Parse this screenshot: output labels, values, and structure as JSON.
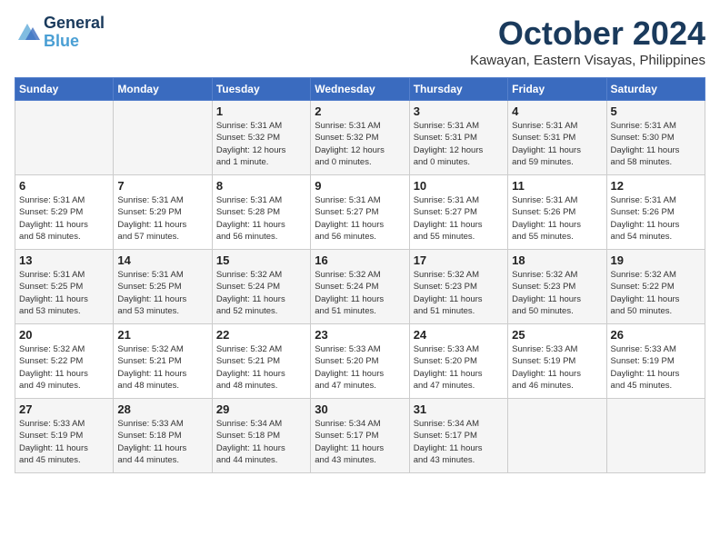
{
  "header": {
    "logo_line1": "General",
    "logo_line2": "Blue",
    "month": "October 2024",
    "location": "Kawayan, Eastern Visayas, Philippines"
  },
  "days_of_week": [
    "Sunday",
    "Monday",
    "Tuesday",
    "Wednesday",
    "Thursday",
    "Friday",
    "Saturday"
  ],
  "weeks": [
    [
      {
        "day": "",
        "info": ""
      },
      {
        "day": "",
        "info": ""
      },
      {
        "day": "1",
        "info": "Sunrise: 5:31 AM\nSunset: 5:32 PM\nDaylight: 12 hours\nand 1 minute."
      },
      {
        "day": "2",
        "info": "Sunrise: 5:31 AM\nSunset: 5:32 PM\nDaylight: 12 hours\nand 0 minutes."
      },
      {
        "day": "3",
        "info": "Sunrise: 5:31 AM\nSunset: 5:31 PM\nDaylight: 12 hours\nand 0 minutes."
      },
      {
        "day": "4",
        "info": "Sunrise: 5:31 AM\nSunset: 5:31 PM\nDaylight: 11 hours\nand 59 minutes."
      },
      {
        "day": "5",
        "info": "Sunrise: 5:31 AM\nSunset: 5:30 PM\nDaylight: 11 hours\nand 58 minutes."
      }
    ],
    [
      {
        "day": "6",
        "info": "Sunrise: 5:31 AM\nSunset: 5:29 PM\nDaylight: 11 hours\nand 58 minutes."
      },
      {
        "day": "7",
        "info": "Sunrise: 5:31 AM\nSunset: 5:29 PM\nDaylight: 11 hours\nand 57 minutes."
      },
      {
        "day": "8",
        "info": "Sunrise: 5:31 AM\nSunset: 5:28 PM\nDaylight: 11 hours\nand 56 minutes."
      },
      {
        "day": "9",
        "info": "Sunrise: 5:31 AM\nSunset: 5:27 PM\nDaylight: 11 hours\nand 56 minutes."
      },
      {
        "day": "10",
        "info": "Sunrise: 5:31 AM\nSunset: 5:27 PM\nDaylight: 11 hours\nand 55 minutes."
      },
      {
        "day": "11",
        "info": "Sunrise: 5:31 AM\nSunset: 5:26 PM\nDaylight: 11 hours\nand 55 minutes."
      },
      {
        "day": "12",
        "info": "Sunrise: 5:31 AM\nSunset: 5:26 PM\nDaylight: 11 hours\nand 54 minutes."
      }
    ],
    [
      {
        "day": "13",
        "info": "Sunrise: 5:31 AM\nSunset: 5:25 PM\nDaylight: 11 hours\nand 53 minutes."
      },
      {
        "day": "14",
        "info": "Sunrise: 5:31 AM\nSunset: 5:25 PM\nDaylight: 11 hours\nand 53 minutes."
      },
      {
        "day": "15",
        "info": "Sunrise: 5:32 AM\nSunset: 5:24 PM\nDaylight: 11 hours\nand 52 minutes."
      },
      {
        "day": "16",
        "info": "Sunrise: 5:32 AM\nSunset: 5:24 PM\nDaylight: 11 hours\nand 51 minutes."
      },
      {
        "day": "17",
        "info": "Sunrise: 5:32 AM\nSunset: 5:23 PM\nDaylight: 11 hours\nand 51 minutes."
      },
      {
        "day": "18",
        "info": "Sunrise: 5:32 AM\nSunset: 5:23 PM\nDaylight: 11 hours\nand 50 minutes."
      },
      {
        "day": "19",
        "info": "Sunrise: 5:32 AM\nSunset: 5:22 PM\nDaylight: 11 hours\nand 50 minutes."
      }
    ],
    [
      {
        "day": "20",
        "info": "Sunrise: 5:32 AM\nSunset: 5:22 PM\nDaylight: 11 hours\nand 49 minutes."
      },
      {
        "day": "21",
        "info": "Sunrise: 5:32 AM\nSunset: 5:21 PM\nDaylight: 11 hours\nand 48 minutes."
      },
      {
        "day": "22",
        "info": "Sunrise: 5:32 AM\nSunset: 5:21 PM\nDaylight: 11 hours\nand 48 minutes."
      },
      {
        "day": "23",
        "info": "Sunrise: 5:33 AM\nSunset: 5:20 PM\nDaylight: 11 hours\nand 47 minutes."
      },
      {
        "day": "24",
        "info": "Sunrise: 5:33 AM\nSunset: 5:20 PM\nDaylight: 11 hours\nand 47 minutes."
      },
      {
        "day": "25",
        "info": "Sunrise: 5:33 AM\nSunset: 5:19 PM\nDaylight: 11 hours\nand 46 minutes."
      },
      {
        "day": "26",
        "info": "Sunrise: 5:33 AM\nSunset: 5:19 PM\nDaylight: 11 hours\nand 45 minutes."
      }
    ],
    [
      {
        "day": "27",
        "info": "Sunrise: 5:33 AM\nSunset: 5:19 PM\nDaylight: 11 hours\nand 45 minutes."
      },
      {
        "day": "28",
        "info": "Sunrise: 5:33 AM\nSunset: 5:18 PM\nDaylight: 11 hours\nand 44 minutes."
      },
      {
        "day": "29",
        "info": "Sunrise: 5:34 AM\nSunset: 5:18 PM\nDaylight: 11 hours\nand 44 minutes."
      },
      {
        "day": "30",
        "info": "Sunrise: 5:34 AM\nSunset: 5:17 PM\nDaylight: 11 hours\nand 43 minutes."
      },
      {
        "day": "31",
        "info": "Sunrise: 5:34 AM\nSunset: 5:17 PM\nDaylight: 11 hours\nand 43 minutes."
      },
      {
        "day": "",
        "info": ""
      },
      {
        "day": "",
        "info": ""
      }
    ]
  ]
}
